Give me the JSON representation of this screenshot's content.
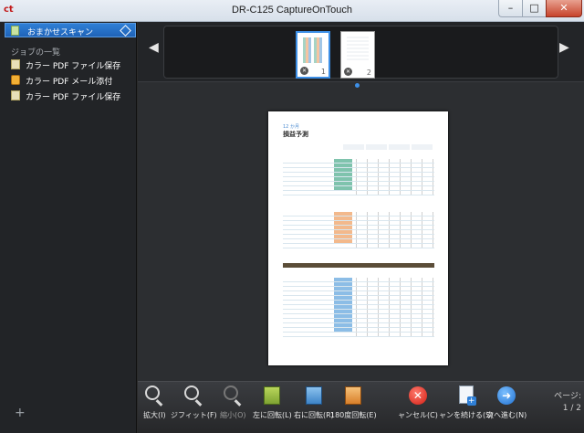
{
  "window": {
    "title": "DR-C125 CaptureOnTouch",
    "app_icon": "ct",
    "minimize": "–",
    "maximize": "□",
    "close": "✕"
  },
  "sidebar": {
    "quick_scan": {
      "label": "おまかせスキャン",
      "accent": "#1f63b8"
    },
    "jobs_header": "ジョブの一覧",
    "jobs": [
      {
        "label": "カラー PDF ファイル保存",
        "icon": "pdf-file-icon"
      },
      {
        "label": "カラー PDF メール添付",
        "icon": "mail-attach-icon"
      },
      {
        "label": "カラー PDF ファイル保存",
        "icon": "pdf-file-icon"
      }
    ],
    "add": "+"
  },
  "thumbnails": {
    "prev": "◀",
    "next": "▶",
    "items": [
      {
        "num": "1",
        "selected": true
      },
      {
        "num": "2",
        "selected": false
      }
    ]
  },
  "document": {
    "subtitle": "12 か月",
    "title": "損益予測"
  },
  "toolbar": {
    "zoom_in": "拡大(I)",
    "fit": "ジフィット(F)",
    "zoom_out": "縮小(O)",
    "rotate_left": "左に回転(L)",
    "rotate_right": "右に回転(R)",
    "rotate_180": "180度回転(E)",
    "cancel": "ャンセル(C)",
    "continue_scan": "ャンを続ける(S)",
    "next": "次へ進む(N)",
    "page_label": "ページ:",
    "page_value": "1 / 2"
  }
}
